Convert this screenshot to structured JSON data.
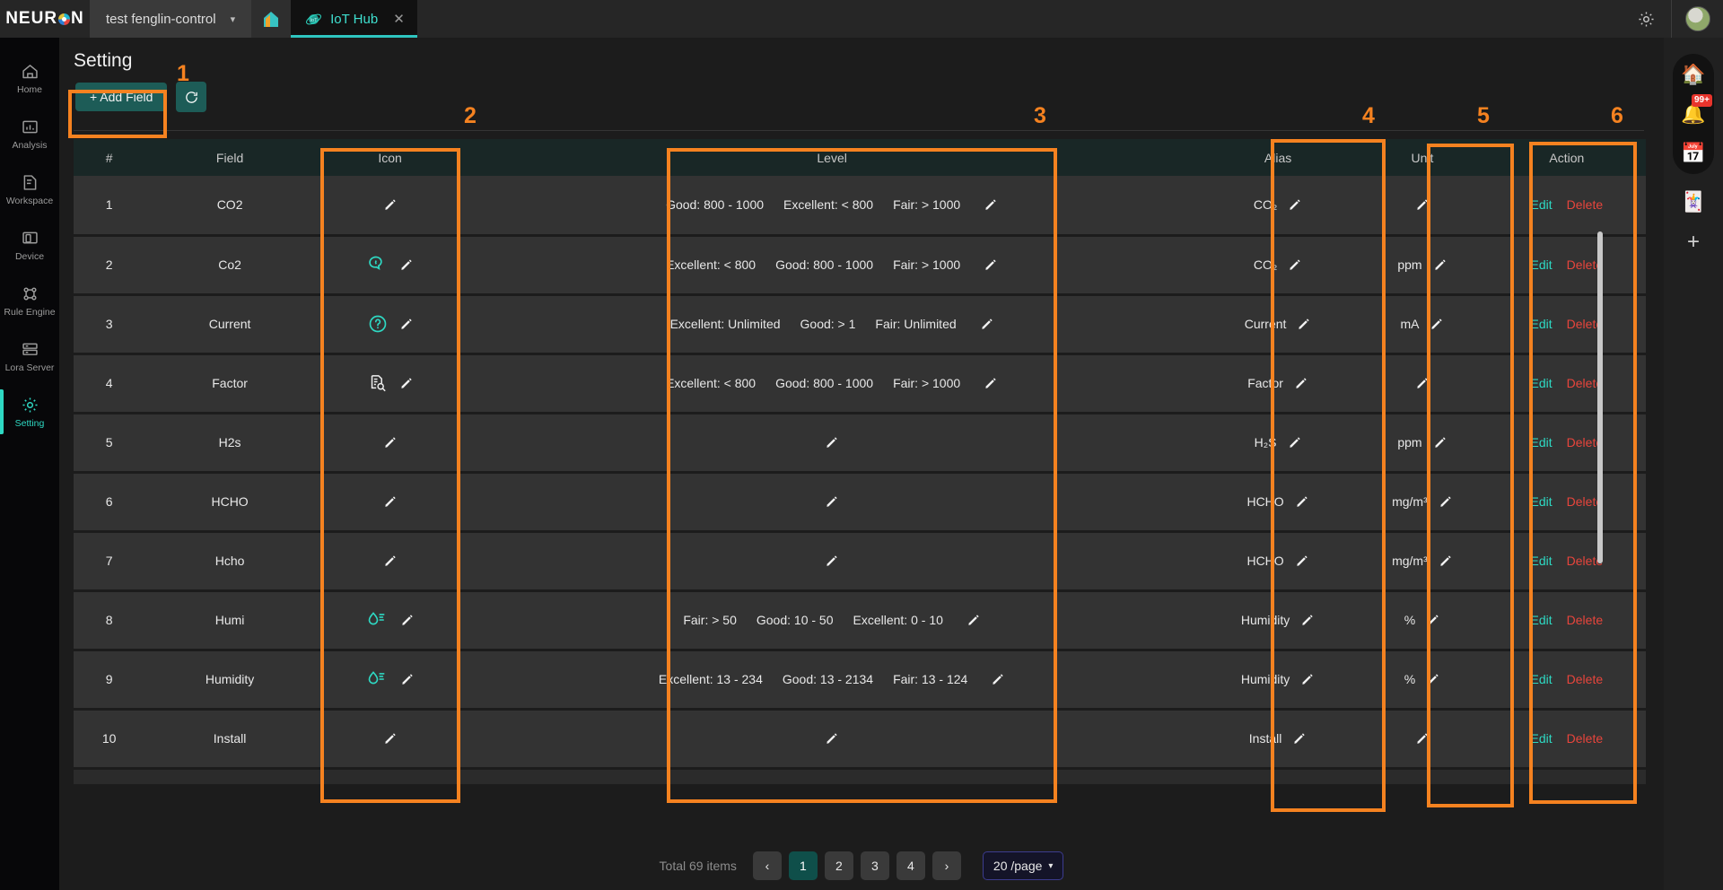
{
  "topbar": {
    "logo": "NEUR N",
    "project_tab": {
      "label": "test fenglin-control",
      "chevron": "chevron-down-icon"
    },
    "home_tab_icon": "home-icon",
    "iot_tab": {
      "label": "IoT Hub",
      "icon": "iot-icon",
      "close": "close-icon"
    },
    "gear_icon": "gear-icon",
    "avatar": "avatar"
  },
  "sidebar": {
    "items": [
      {
        "label": "Home",
        "icon": "home-icon",
        "active": false
      },
      {
        "label": "Analysis",
        "icon": "analysis-chart-icon",
        "active": false
      },
      {
        "label": "Workspace",
        "icon": "document-icon",
        "active": false
      },
      {
        "label": "Device",
        "icon": "device-icon",
        "active": false
      },
      {
        "label": "Rule Engine",
        "icon": "rule-engine-icon",
        "active": false
      },
      {
        "label": "Lora Server",
        "icon": "server-icon",
        "active": false
      },
      {
        "label": "Setting",
        "icon": "gear-icon",
        "active": true
      }
    ]
  },
  "right_rail": {
    "items": [
      {
        "name": "house-emoji-icon",
        "glyph": "🏠",
        "badge": ""
      },
      {
        "name": "bell-alert-icon",
        "glyph": "🔔",
        "badge": "99+"
      },
      {
        "name": "calendar-add-icon",
        "glyph": "📅",
        "badge": ""
      },
      {
        "name": "card-stack-icon",
        "glyph": "🃏",
        "badge": ""
      }
    ],
    "add_label": "+"
  },
  "page": {
    "title": "Setting"
  },
  "toolbar": {
    "add_field_label": "+ Add Field",
    "refresh_icon": "refresh-icon"
  },
  "table": {
    "columns": [
      "#",
      "Field",
      "Icon",
      "Level",
      "Alias",
      "Unit",
      "Action"
    ],
    "rows": [
      {
        "num": "1",
        "field": "CO2",
        "icon": "",
        "level": [
          "Good: 800 - 1000",
          "Excellent: < 800",
          "Fair: > 1000"
        ],
        "alias": "CO₂",
        "unit": "",
        "edit": "Edit",
        "delete": "Delete"
      },
      {
        "num": "2",
        "field": "Co2",
        "icon": "chat-bubble-icon",
        "level": [
          "Excellent: < 800",
          "Good: 800 - 1000",
          "Fair: > 1000"
        ],
        "alias": "CO₂",
        "unit": "ppm",
        "edit": "Edit",
        "delete": "Delete"
      },
      {
        "num": "3",
        "field": "Current",
        "icon": "question-icon",
        "level": [
          "Excellent: Unlimited",
          "Good: > 1",
          "Fair: Unlimited"
        ],
        "alias": "Current",
        "unit": "mA",
        "edit": "Edit",
        "delete": "Delete"
      },
      {
        "num": "4",
        "field": "Factor",
        "icon": "doc-search-icon",
        "level": [
          "Excellent: < 800",
          "Good: 800 - 1000",
          "Fair: > 1000"
        ],
        "alias": "Factor",
        "unit": "",
        "edit": "Edit",
        "delete": "Delete"
      },
      {
        "num": "5",
        "field": "H2s",
        "icon": "",
        "level": [],
        "alias": "H₂S",
        "unit": "ppm",
        "edit": "Edit",
        "delete": "Delete"
      },
      {
        "num": "6",
        "field": "HCHO",
        "icon": "",
        "level": [],
        "alias": "HCHO",
        "unit": "mg/m³",
        "edit": "Edit",
        "delete": "Delete"
      },
      {
        "num": "7",
        "field": "Hcho",
        "icon": "",
        "level": [],
        "alias": "HCHO",
        "unit": "mg/m³",
        "edit": "Edit",
        "delete": "Delete"
      },
      {
        "num": "8",
        "field": "Humi",
        "icon": "humidity-icon",
        "level": [
          "Fair: > 50",
          "Good: 10 - 50",
          "Excellent: 0 - 10"
        ],
        "alias": "Humidity",
        "unit": "%",
        "edit": "Edit",
        "delete": "Delete"
      },
      {
        "num": "9",
        "field": "Humidity",
        "icon": "humidity-icon",
        "level": [
          "Excellent: 13 - 234",
          "Good: 13 - 2134",
          "Fair: 13 - 124"
        ],
        "alias": "Humidity",
        "unit": "%",
        "edit": "Edit",
        "delete": "Delete"
      },
      {
        "num": "10",
        "field": "Install",
        "icon": "",
        "level": [],
        "alias": "Install",
        "unit": "",
        "edit": "Edit",
        "delete": "Delete"
      }
    ]
  },
  "pagination": {
    "total_text": "Total 69 items",
    "prev": "‹",
    "pages": [
      "1",
      "2",
      "3",
      "4"
    ],
    "current_page": "1",
    "next": "›",
    "page_size": "20 /page",
    "page_size_chevron": "chevron-down-icon"
  },
  "annotations": [
    {
      "label": "1"
    },
    {
      "label": "2"
    },
    {
      "label": "3"
    },
    {
      "label": "4"
    },
    {
      "label": "5"
    },
    {
      "label": "6"
    }
  ],
  "colors": {
    "accent_teal": "#2ed9c3",
    "annotation_orange": "#F58220",
    "delete_red": "#e8453c",
    "header_bg": "#192726",
    "row_bg": "#333333"
  }
}
